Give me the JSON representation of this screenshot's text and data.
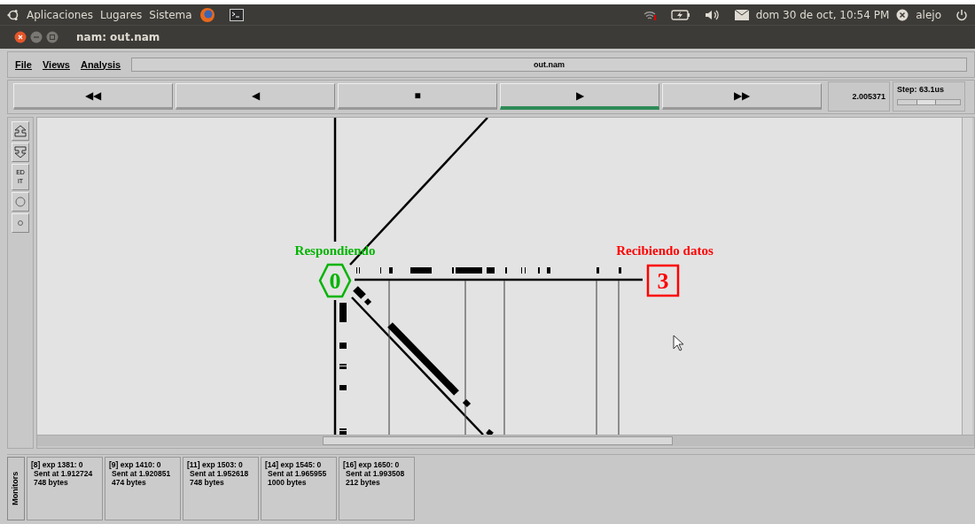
{
  "top_panel": {
    "menus": [
      "Aplicaciones",
      "Lugares",
      "Sistema"
    ],
    "clock": "dom 30 de oct, 10:54 PM",
    "user": "alejo"
  },
  "window": {
    "title": "nam: out.nam"
  },
  "menu_bar": {
    "items": [
      "File",
      "Views",
      "Analysis"
    ],
    "file_name": "out.nam"
  },
  "transport": {
    "buttons": [
      {
        "label": "◀◀",
        "selected": false
      },
      {
        "label": "◀",
        "selected": false
      },
      {
        "label": "■",
        "selected": false
      },
      {
        "label": "▶",
        "selected": true
      },
      {
        "label": "▶▶",
        "selected": false
      }
    ],
    "time": "2.005371",
    "step": "Step: 63.1us",
    "step_slider": {
      "level": 0.45
    }
  },
  "tools": [
    {
      "kind": "icon"
    },
    {
      "kind": "icon"
    },
    {
      "kind": "text",
      "label": "ED IT"
    },
    {
      "kind": "icon"
    },
    {
      "kind": "icon"
    }
  ],
  "nodes": [
    {
      "id_label": "0",
      "label": "Respondiendo",
      "color": "#00b400",
      "kind": "hexagon"
    },
    {
      "id_label": "3",
      "label": "Recibiendo datos",
      "color": "#ff0000",
      "kind": "square"
    }
  ],
  "monitors": {
    "title": "Monitors",
    "items": [
      {
        "lines": [
          "[8] exp 1381: 0",
          "Sent at 1.912724",
          "748 bytes"
        ]
      },
      {
        "lines": [
          "[9] exp 1410: 0",
          "Sent at 1.920851",
          "474 bytes"
        ]
      },
      {
        "lines": [
          "[11] exp 1503: 0",
          "Sent at 1.952618",
          "748 bytes"
        ]
      },
      {
        "lines": [
          "[14] exp 1545: 0",
          "Sent at 1.965955",
          "1000 bytes"
        ]
      },
      {
        "lines": [
          "[16] exp 1650: 0",
          "Sent at 1.993508",
          "212 bytes"
        ]
      }
    ]
  }
}
